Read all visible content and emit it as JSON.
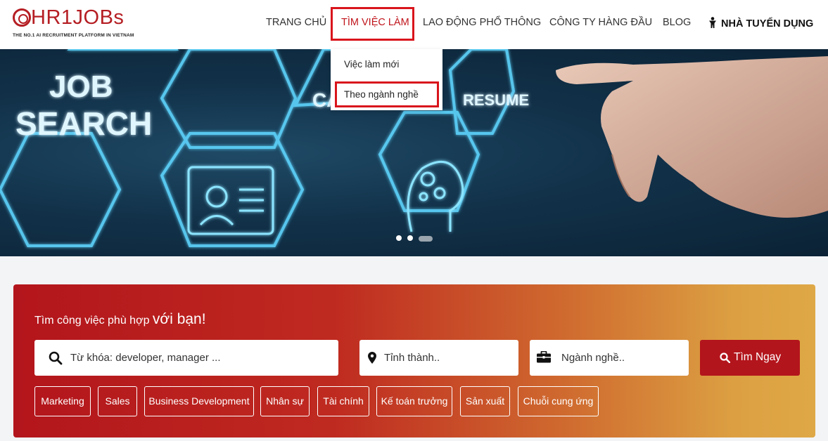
{
  "logo": {
    "name": "HR1JOBs",
    "tagline": "THE NO.1 AI RECRUITMENT PLATFORM IN VIETNAM",
    "brand_color": "#b51e23"
  },
  "nav": {
    "items": [
      {
        "label": "TRANG CHỦ",
        "active": false
      },
      {
        "label": "TÌM VIỆC LÀM",
        "active": true
      },
      {
        "label": "LAO ĐỘNG PHỔ THÔNG",
        "active": false
      },
      {
        "label": "CÔNG TY HÀNG ĐẦU",
        "active": false
      },
      {
        "label": "BLOG",
        "active": false
      }
    ],
    "employer": {
      "label": "NHÀ TUYỂN DỤNG",
      "icon": "person-icon"
    },
    "active_color": "#c0161c"
  },
  "dropdown": {
    "items": [
      {
        "label": "Việc làm mới"
      },
      {
        "label": "Theo ngành nghề",
        "highlighted": true
      }
    ]
  },
  "hero": {
    "text_job": "JOB",
    "text_search": "SEARCH",
    "text_ca": "CA",
    "text_resume": "RESUME",
    "slides": 3,
    "active_slide": 3
  },
  "search": {
    "title_small": "Tìm công việc phù hợp",
    "title_big": "với bạn!",
    "keyword_placeholder": "Từ khóa: developer, manager ...",
    "location_placeholder": "Tỉnh thành..",
    "industry_placeholder": "Ngành nghề..",
    "button_label": "Tìm Ngay",
    "tags": [
      "Marketing",
      "Sales",
      "Business Development",
      "Nhân sự",
      "Tài chính",
      "Kế toán trưởng",
      "Sản xuất",
      "Chuỗi cung ứng"
    ],
    "gradient_start": "#b3151c",
    "gradient_end": "#dfa846"
  }
}
